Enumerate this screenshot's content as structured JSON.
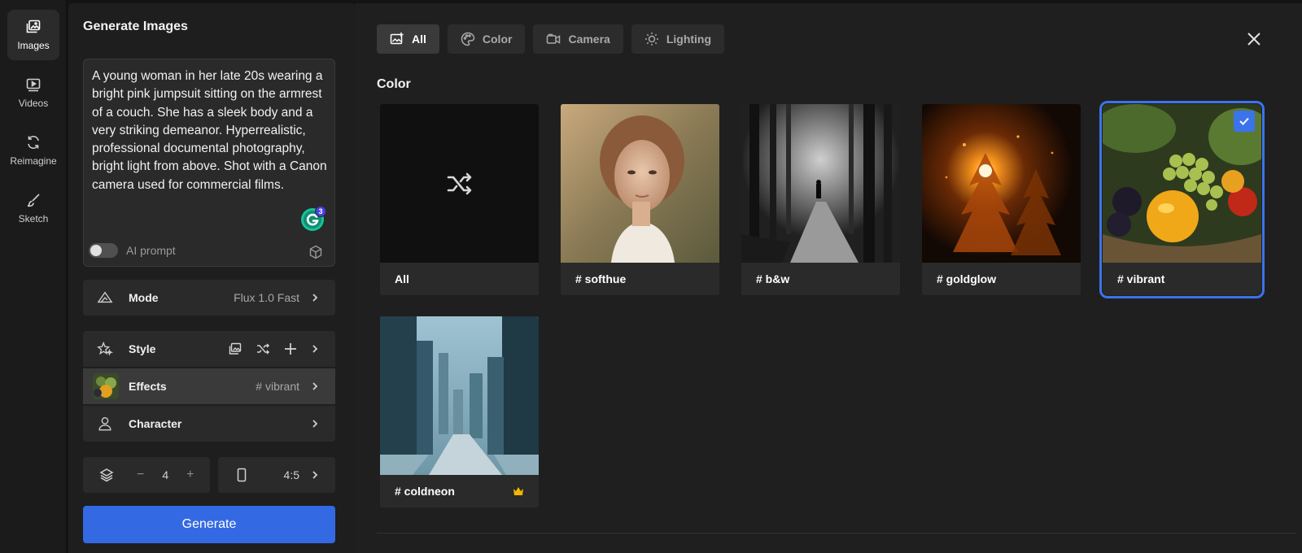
{
  "rail": {
    "items": [
      {
        "label": "Images",
        "icon": "images-icon",
        "active": true
      },
      {
        "label": "Videos",
        "icon": "video-icon",
        "active": false
      },
      {
        "label": "Reimagine",
        "icon": "refresh-icon",
        "active": false
      },
      {
        "label": "Sketch",
        "icon": "brush-icon",
        "active": false
      }
    ]
  },
  "panel": {
    "title": "Generate Images",
    "prompt": "A young woman in her late 20s wearing a bright pink jumpsuit sitting on the armrest of a couch. She has a sleek body and a very striking demeanor. Hyperrealistic, professional documental photography, bright light from above. Shot with a Canon camera used for commercial films.",
    "grammarly_badge": "3",
    "ai_prompt_label": "AI prompt",
    "mode": {
      "label": "Mode",
      "value": "Flux 1.0 Fast"
    },
    "style": {
      "label": "Style"
    },
    "effects": {
      "label": "Effects",
      "value": "# vibrant"
    },
    "character": {
      "label": "Character"
    },
    "count": {
      "value": "4",
      "minus": "−",
      "plus": "+"
    },
    "ratio": {
      "value": "4:5"
    },
    "generate_label": "Generate"
  },
  "main": {
    "tabs": [
      {
        "label": "All",
        "icon": "image-plus-icon",
        "active": true
      },
      {
        "label": "Color",
        "icon": "palette-icon",
        "active": false
      },
      {
        "label": "Camera",
        "icon": "camera-icon",
        "active": false
      },
      {
        "label": "Lighting",
        "icon": "sun-icon",
        "active": false
      }
    ],
    "section_title": "Color",
    "cards": [
      {
        "label": "All",
        "selected": false
      },
      {
        "label": "# softhue",
        "selected": false
      },
      {
        "label": "# b&w",
        "selected": false
      },
      {
        "label": "# goldglow",
        "selected": false
      },
      {
        "label": "# vibrant",
        "selected": true
      },
      {
        "label": "# coldneon",
        "selected": false,
        "premium": true
      }
    ]
  },
  "colors": {
    "accent": "#3469e4",
    "selection": "#3b73ea",
    "crown": "#f2b600"
  }
}
